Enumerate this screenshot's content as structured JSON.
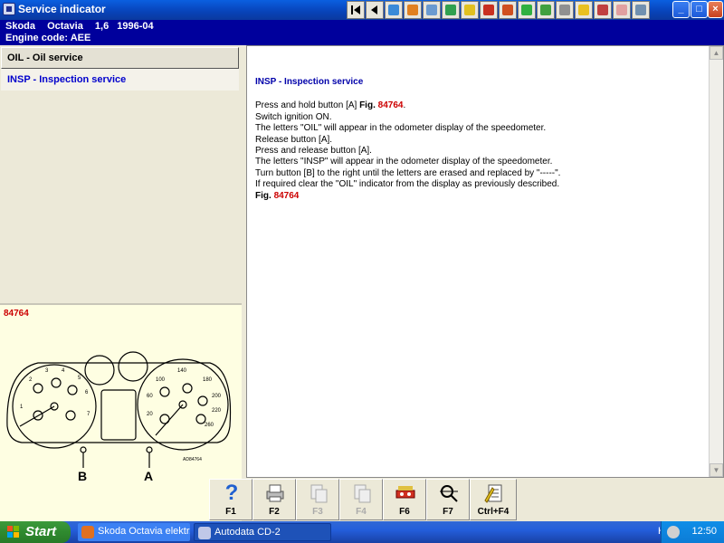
{
  "window": {
    "title": "Service indicator"
  },
  "toolbar": {
    "icons": [
      "first-icon",
      "prev-icon",
      "data-icon",
      "service-icon",
      "tools-icon",
      "repair-icon",
      "electrical-icon",
      "battery-icon",
      "engine-icon",
      "emission-icon",
      "tire-icon",
      "ac-icon",
      "airbag-icon",
      "brake-icon",
      "lamp-icon",
      "gear-icon"
    ]
  },
  "vehicle": {
    "make": "Skoda",
    "model": "Octavia",
    "engine": "1,6",
    "year": "1996-04",
    "engine_code": "Engine code: AEE"
  },
  "menu": {
    "oil": "OIL - Oil service",
    "insp": "INSP - Inspection service"
  },
  "figure": {
    "number": "84764",
    "label_a": "A",
    "label_b": "B",
    "code": "AD84764"
  },
  "content": {
    "heading": "INSP - Inspection service",
    "l1_pre": "Press and hold button [A] ",
    "fig_word": "Fig.",
    "fig_num": "84764",
    "l1_post": ".",
    "l2": "Switch ignition ON.",
    "l3": "The letters \"OIL\" will appear in the odometer display of the speedometer.",
    "l4": "Release button [A].",
    "l5": "Press and release button [A].",
    "l6": "The letters \"INSP\" will appear in the odometer display of the speedometer.",
    "l7": "Turn button [B] to the right until the letters are erased and replaced by \"-----\".",
    "l8": "If required clear the \"OIL\" indicator from the display as previously described.",
    "fig_word2": "Fig.",
    "fig_num2": "84764"
  },
  "fkeys": {
    "f1": "F1",
    "f2": "F2",
    "f3": "F3",
    "f4": "F4",
    "f6": "F6",
    "f7": "F7",
    "ctrlf4": "Ctrl+F4"
  },
  "taskbar": {
    "start": "Start",
    "task1": "Skoda Octavia elektr...",
    "task2": "Autodata CD-2",
    "lang": "HU",
    "clock": "12:50"
  },
  "colors": {
    "title_blue": "#0842b8",
    "header_navy": "#00009c",
    "accent_red": "#cc0000",
    "link_blue": "#0000cc"
  }
}
